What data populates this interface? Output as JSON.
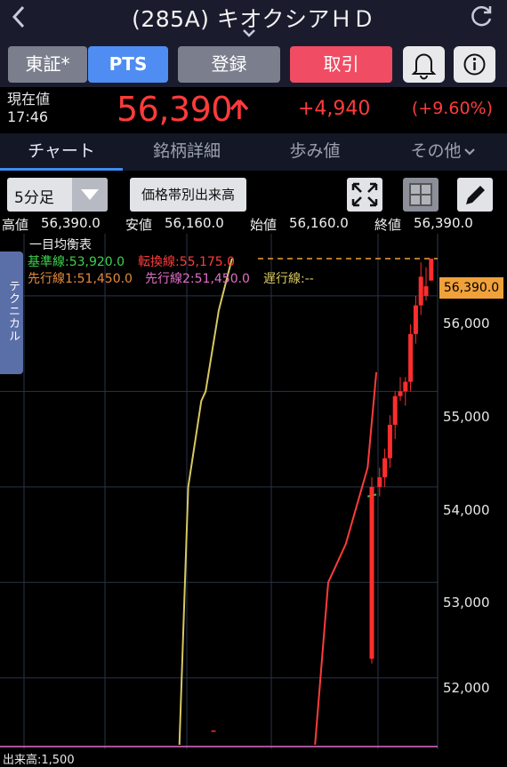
{
  "header": {
    "back_icon": "chevron-left-icon",
    "title": "(285A) キオクシアＨＤ",
    "refresh_icon": "refresh-icon"
  },
  "buttons": {
    "exchange": "東証*",
    "pts": "PTS",
    "register": "登録",
    "trade": "取引"
  },
  "price": {
    "label": "現在値",
    "time": "17:46",
    "value": "56,390",
    "change": "+4,940",
    "change_pct": "(+9.60%)",
    "up_color": "#ff3b3b"
  },
  "tabs": [
    {
      "label": "チャート"
    },
    {
      "label": "銘柄詳細"
    },
    {
      "label": "歩み値"
    },
    {
      "label": "その他"
    }
  ],
  "toolbar": {
    "interval": "5分足",
    "volume_by_price": "価格帯別出来高"
  },
  "ohlc": {
    "high_label": "高値",
    "high": "56,390.0",
    "low_label": "安値",
    "low": "56,160.0",
    "open_label": "始値",
    "open": "56,160.0",
    "close_label": "終値",
    "close": "56,390.0"
  },
  "technical_tab": "テクニカル",
  "legend": {
    "title": "一目均衡表",
    "kijun": "基準線:53,920.0",
    "tenkan": "転換線:55,175.0",
    "senkou1": "先行線1:51,450.0",
    "senkou2": "先行線2:51,450.0",
    "chikou": "遅行線:--"
  },
  "volume_label": "出来高:1,500",
  "chart_data": {
    "type": "candlestick",
    "ylim": [
      51300,
      56650
    ],
    "y_ticks": [
      52000,
      53000,
      54000,
      55000,
      56000
    ],
    "y_tick_labels": [
      "52,000",
      "53,000",
      "54,000",
      "55,000",
      "56,000"
    ],
    "current_price_label": "56,390.0",
    "current_price": 56390,
    "candles": [
      {
        "o": 51450,
        "h": 51450,
        "l": 51450,
        "c": 51450
      },
      {
        "o": 52200,
        "h": 54100,
        "l": 52150,
        "c": 54000
      },
      {
        "o": 54000,
        "h": 54200,
        "l": 53900,
        "c": 54100
      },
      {
        "o": 54100,
        "h": 54400,
        "l": 54000,
        "c": 54300
      },
      {
        "o": 54300,
        "h": 54750,
        "l": 54200,
        "c": 54650
      },
      {
        "o": 54650,
        "h": 55000,
        "l": 54500,
        "c": 54950
      },
      {
        "o": 54950,
        "h": 55150,
        "l": 54900,
        "c": 55000
      },
      {
        "o": 55000,
        "h": 55150,
        "l": 54850,
        "c": 55100
      },
      {
        "o": 55100,
        "h": 55700,
        "l": 55000,
        "c": 55600
      },
      {
        "o": 55600,
        "h": 56000,
        "l": 55500,
        "c": 55900
      },
      {
        "o": 55900,
        "h": 56350,
        "l": 55800,
        "c": 56200
      },
      {
        "o": 56000,
        "h": 56300,
        "l": 55950,
        "c": 56100
      },
      {
        "o": 56160,
        "h": 56390,
        "l": 56160,
        "c": 56390
      }
    ],
    "lines": [
      {
        "name": "chikou",
        "color": "#d8c860",
        "points": [
          [
            0.41,
            51300
          ],
          [
            0.43,
            54000
          ],
          [
            0.46,
            54900
          ],
          [
            0.47,
            55000
          ],
          [
            0.5,
            55850
          ],
          [
            0.53,
            56390
          ]
        ]
      },
      {
        "name": "tenkan",
        "color": "#ff3b3b",
        "points": [
          [
            0.72,
            51300
          ],
          [
            0.75,
            53000
          ],
          [
            0.79,
            53400
          ],
          [
            0.84,
            54200
          ],
          [
            0.86,
            55200
          ]
        ]
      },
      {
        "name": "kijun",
        "color": "#3fd14d",
        "points": [
          [
            0.84,
            53900
          ],
          [
            0.86,
            53920
          ]
        ]
      }
    ]
  }
}
